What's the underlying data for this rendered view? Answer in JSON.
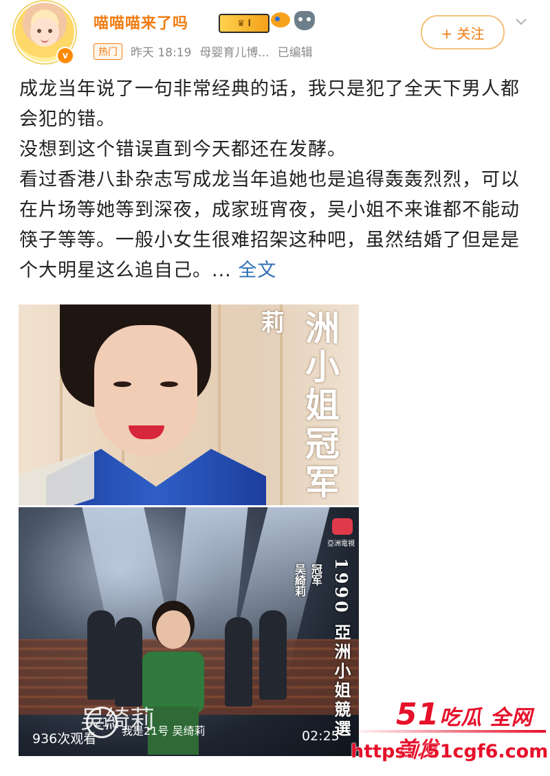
{
  "header": {
    "username": "喵喵喵来了吗",
    "vip_level": "I",
    "verified_mark": "v",
    "hot_tag": "热门",
    "time": "昨天 18:19",
    "source": "母婴育儿博...",
    "edited": "已编辑",
    "follow_label": "+ 关注"
  },
  "post": {
    "paragraphs": [
      "成龙当年说了一句非常经典的话，我只是犯了全天下男人都会犯的错。",
      "没想到这个错误直到今天都还在发酵。",
      "看过香港八卦杂志写成龙当年追她也是追得轰轰烈烈，可以在片场等她等到深夜，成家班宵夜，吴小姐不来谁都不能动筷子等等。一般小女生很难招架这种吧，虽然结婚了但是是个大明星这么追自己。..."
    ],
    "more_label": "全文"
  },
  "image1": {
    "vertical_big": "洲小姐冠军",
    "vertical_small": "莉"
  },
  "image2": {
    "tv_logo_text": "亞洲電視",
    "contest": "1990 亞洲小姐競選",
    "winner": "冠军",
    "name": "吴綺莉",
    "number": "21",
    "caption_big": "吴綺莉",
    "caption_small": "我是21号 吴绮莉",
    "views": "936次观看",
    "duration": "02:25"
  },
  "watermark": {
    "num": "51",
    "brand": "吃瓜 全网首发",
    "url": "https://51cgf6.com"
  },
  "colors": {
    "username": "#f07c12",
    "link": "#2f6fb5",
    "watermark": "#e6102a"
  }
}
